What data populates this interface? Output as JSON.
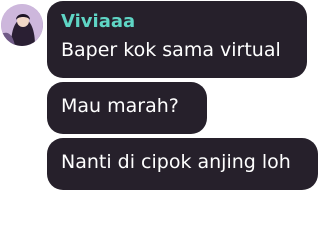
{
  "chat": {
    "sender": "Viviaaa",
    "messages": [
      {
        "text": "Baper kok sama virtual"
      },
      {
        "text": "Mau marah?"
      },
      {
        "text": "Nanti di cipok anjing loh"
      }
    ]
  },
  "colors": {
    "bubble": "#26202b",
    "sender_name": "#5fd5c5",
    "message_text": "#ffffff"
  },
  "icons": {
    "avatar": "user-avatar-photo"
  }
}
